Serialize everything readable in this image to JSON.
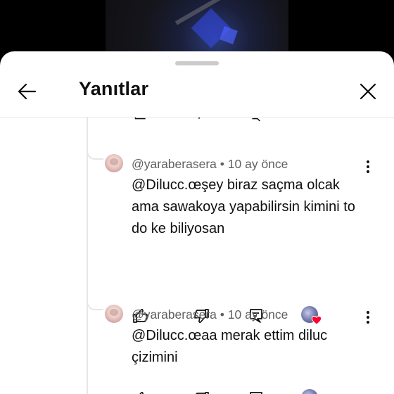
{
  "header": {
    "title": "Yanıtlar"
  },
  "replies": [
    {
      "author": "@yaraberasera",
      "separator": "•",
      "time": "10 ay önce",
      "text": "@Dilucc.œşey biraz saçma olcak ama sawakoya yapabilirsin kimini to do ke biliyosan"
    },
    {
      "author": "@yaraberasera",
      "separator": "•",
      "time": "10 ay önce",
      "text": "@Dilucc.œaa merak ettim diluc çizimini"
    }
  ],
  "icons": {
    "back": "arrow-left-icon",
    "close": "close-icon",
    "more": "more-vert-icon",
    "like": "thumb-up-icon",
    "dislike": "thumb-down-icon",
    "reply": "comment-reply-icon",
    "creator_heart": "creator-heart-icon"
  },
  "colors": {
    "text": "#0f0f0f",
    "meta": "#606060",
    "heart": "#ff0033",
    "divider": "#e5e5e5"
  }
}
